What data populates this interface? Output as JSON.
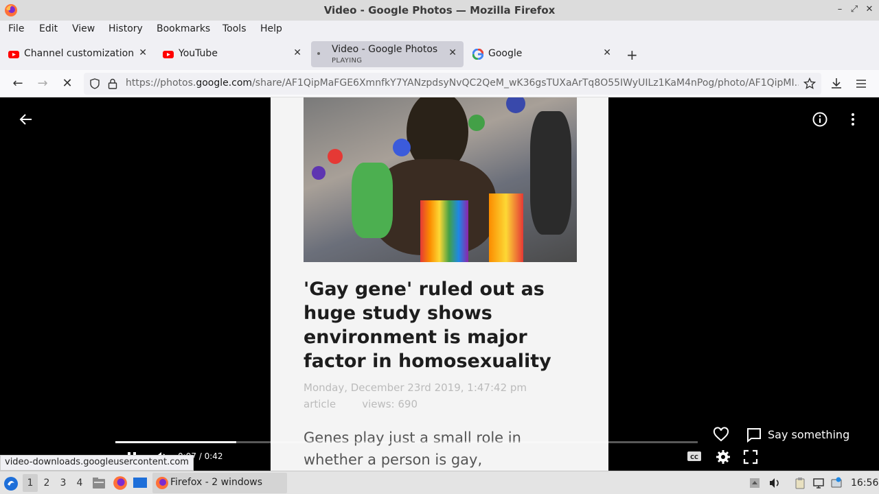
{
  "window": {
    "title": "Video - Google Photos — Mozilla Firefox"
  },
  "menu": [
    "File",
    "Edit",
    "View",
    "History",
    "Bookmarks",
    "Tools",
    "Help"
  ],
  "tabs": [
    {
      "label": "Channel customization -",
      "favicon": "youtube-icon"
    },
    {
      "label": "YouTube",
      "favicon": "youtube-icon"
    },
    {
      "label": "Video - Google Photos",
      "sublabel": "PLAYING",
      "favicon": "dot-icon"
    },
    {
      "label": "Google",
      "favicon": "google-icon"
    }
  ],
  "nav": {
    "url_prefix": "https://photos.",
    "url_domain": "google.com",
    "url_rest": "/share/AF1QipMaFGE6XmnfkY7YANzpdsyNvQC2QeM_wK36gsTUXaArTq8O55IWyUILz1KaM4nPog/photo/AF1QipMI..."
  },
  "article": {
    "headline": "'Gay gene' ruled out as huge study shows environment is major factor in homosexuality",
    "date": "Monday, December 23rd 2019, 1:47:42 pm",
    "meta": "article        views: 690",
    "sub": "Genes play just a small role in whether a person is gay,"
  },
  "player": {
    "time": "0:07 / 0:42",
    "progress": 0.207,
    "comment_label": "Say something"
  },
  "status": {
    "text": "video-downloads.googleusercontent.com"
  },
  "taskbar": {
    "workspaces": [
      "1",
      "2",
      "3",
      "4"
    ],
    "active_workspace": "1",
    "firefox_label": "Firefox - 2 windows",
    "clock": "16:56"
  },
  "colors": {
    "accent_youtube": "#ff0000",
    "firefox_orange": "#ff7139"
  }
}
